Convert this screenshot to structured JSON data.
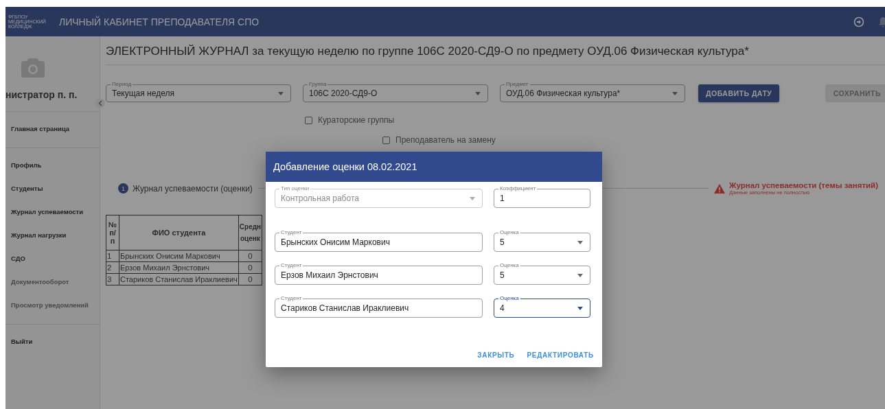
{
  "header": {
    "logo_lines": [
      "ФГБПОУ",
      "МЕДИЦИНСКИЙ",
      "КОЛЛЕДЖ"
    ],
    "title": "ЛИЧНЫЙ КАБИНЕТ ПРЕПОДАВАТЕЛЯ СПО"
  },
  "sidebar": {
    "user_name": "нистратор п. п.",
    "sections": [
      {
        "items": [
          {
            "label": "Главная страница",
            "disabled": false
          }
        ]
      },
      {
        "items": [
          {
            "label": "Профиль",
            "disabled": false
          },
          {
            "label": "Студенты",
            "disabled": false
          },
          {
            "label": "Журнал успеваемости",
            "disabled": false
          },
          {
            "label": "Журнал нагрузки",
            "disabled": false
          },
          {
            "label": "СДО",
            "disabled": false
          },
          {
            "label": "Документооборот",
            "disabled": true
          },
          {
            "label": "Просмотр уведомлений",
            "disabled": true
          }
        ]
      },
      {
        "items": [
          {
            "label": "Выйти",
            "disabled": false
          }
        ]
      }
    ]
  },
  "page": {
    "title": "ЭЛЕКТРОННЫЙ ЖУРНАЛ за текущую неделю по группе 106С 2020-СД9-О по предмету ОУД.06 Физическая культура*",
    "filters": [
      {
        "label": "Период",
        "value": "Текущая неделя"
      },
      {
        "label": "Группа",
        "value": "106С 2020-СД9-О"
      },
      {
        "label": "Предмет",
        "value": "ОУД.06 Физическая культура*"
      }
    ],
    "add_date_button": {
      "label": "ДОБАВИТЬ ДАТУ",
      "disabled": false
    },
    "save_button": {
      "label": "СОХРАНИТЬ",
      "disabled": true
    },
    "checkboxes": [
      {
        "label": "Кураторские группы",
        "checked": false
      },
      {
        "label": "Преподаватель на замену",
        "checked": false
      }
    ],
    "steps": [
      {
        "kind": "number",
        "number": "1",
        "label": "Журнал успеваемости (оценки)"
      },
      {
        "kind": "warning",
        "label": "Журнал успеваемости (темы занятий)",
        "note": "Данные заполнены не полностью"
      }
    ],
    "table": {
      "columns": [
        "№ п/п",
        "ФИО студента",
        "Средн оценк"
      ],
      "rows": [
        [
          "1",
          "Брынских Онисим Маркович",
          "0"
        ],
        [
          "2",
          "Ерзов Михаил Эрнстович",
          "0"
        ],
        [
          "3",
          "Стариков Станислав Ираклиевич",
          "0"
        ]
      ]
    }
  },
  "dialog": {
    "title": "Добавление оценки 08.02.2021",
    "rows": [
      [
        {
          "kind": "select",
          "label": "Тип оценки",
          "value": "Контрольная работа",
          "disabled": true,
          "focused": false
        },
        {
          "kind": "input",
          "label": "Коэффициент",
          "value": "1",
          "disabled": false,
          "focused": false
        }
      ],
      [
        {
          "kind": "input",
          "label": "Студент",
          "value": "Брынских Онисим Маркович",
          "disabled": false,
          "focused": false
        },
        {
          "kind": "select",
          "label": "Оценка",
          "value": "5",
          "disabled": false,
          "focused": false
        }
      ],
      [
        {
          "kind": "input",
          "label": "Студент",
          "value": "Ерзов Михаил Эрнстович",
          "disabled": false,
          "focused": false
        },
        {
          "kind": "select",
          "label": "Оценка",
          "value": "5",
          "disabled": false,
          "focused": false
        }
      ],
      [
        {
          "kind": "input",
          "label": "Студент",
          "value": "Стариков Станислав Ираклиевич",
          "disabled": false,
          "focused": false
        },
        {
          "kind": "select",
          "label": "Оценка",
          "value": "4",
          "disabled": false,
          "focused": true
        }
      ]
    ],
    "buttons": [
      "ЗАКРЫТЬ",
      "РЕДАКТИРОВАТЬ"
    ]
  }
}
